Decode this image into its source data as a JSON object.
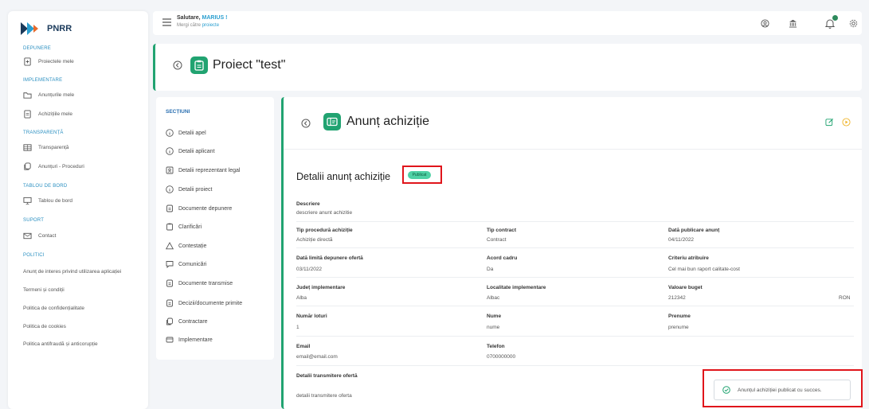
{
  "logo": {
    "text": "PNRR"
  },
  "sidebar": {
    "sections": [
      {
        "title": "DEPUNERE",
        "items": [
          {
            "label": "Proiectele mele",
            "icon": "file-plus-icon"
          }
        ]
      },
      {
        "title": "IMPLEMENTARE",
        "items": [
          {
            "label": "Anunțurile mele",
            "icon": "folder-icon"
          },
          {
            "label": "Achizițiile mele",
            "icon": "document-icon"
          }
        ]
      },
      {
        "title": "TRANSPARENȚĂ",
        "items": [
          {
            "label": "Transparență",
            "icon": "table-icon"
          },
          {
            "label": "Anunțuri - Proceduri",
            "icon": "copy-icon"
          }
        ]
      },
      {
        "title": "TABLOU DE BORD",
        "items": [
          {
            "label": "Tablou de bord",
            "icon": "presentation-icon"
          }
        ]
      },
      {
        "title": "SUPORT",
        "items": [
          {
            "label": "Contact",
            "icon": "mail-icon"
          }
        ]
      }
    ],
    "politici_title": "POLITICI",
    "politici": [
      "Anunț de interes privind utilizarea aplicației",
      "Termeni și condiții",
      "Politica de confidențialitate",
      "Politica de cookies",
      "Politica antifraudă și anticorupție"
    ]
  },
  "header": {
    "greeting": "Salutare, ",
    "user": "MARIUS !",
    "sub_prefix": "Mergi către ",
    "sub_link": "proiecte"
  },
  "project": {
    "title": "Proiect \"test\""
  },
  "sections_panel": {
    "title": "SECȚIUNI",
    "items": [
      "Detalii apel",
      "Detalii aplicant",
      "Detalii reprezentant legal",
      "Detalii proiect",
      "Documente depunere",
      "Clarificări",
      "Contestație",
      "Comunicări",
      "Documente transmise",
      "Decizii/documente primite",
      "Contractare",
      "Implementare"
    ]
  },
  "main": {
    "title": "Anunț achiziție",
    "details_title": "Detalii anunț achiziție",
    "status_badge": "Publicat",
    "descriere": {
      "label": "Descriere",
      "value": "descriere anunt achizitie"
    },
    "fields": [
      {
        "label": "Tip procedură achiziție",
        "value": "Achiziție directă"
      },
      {
        "label": "Tip contract",
        "value": "Contract"
      },
      {
        "label": "Dată publicare anunț",
        "value": "04/11/2022"
      },
      {
        "label": "Dată limită depunere ofertă",
        "value": "03/11/2022"
      },
      {
        "label": "Acord cadru",
        "value": "Da"
      },
      {
        "label": "Criteriu atribuire",
        "value": "Cel mai bun raport calitate-cost"
      },
      {
        "label": "Județ implementare",
        "value": "Alba"
      },
      {
        "label": "Localitate implementare",
        "value": "Albac"
      },
      {
        "label": "Valoare buget",
        "value": "212342"
      },
      {
        "label": "Număr loturi",
        "value": "1"
      },
      {
        "label": "Nume",
        "value": "nume"
      },
      {
        "label": "Prenume",
        "value": "prenume"
      },
      {
        "label": "Email",
        "value": "email@email.com"
      },
      {
        "label": "Telefon",
        "value": "0700000000"
      }
    ],
    "currency": "RON",
    "transmitere": {
      "label": "Detalii transmitere ofertă",
      "value": "detalii transmitere oferta"
    }
  },
  "toast": {
    "message": "Anunțul achiziției publicat cu succes."
  },
  "colors": {
    "accent": "#21a371",
    "link": "#2a9fd0",
    "highlight": "#e0151b"
  }
}
